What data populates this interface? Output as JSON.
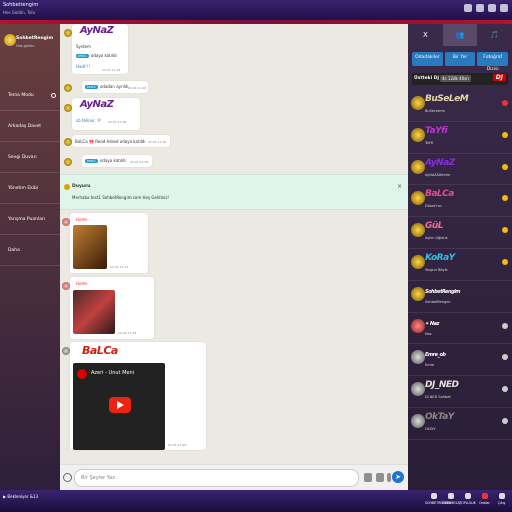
{
  "app": {
    "brand": "Sohbetrengim",
    "brand_sub": "Hos Geldin, Tela"
  },
  "sidebar": {
    "user_name": "SohbetRengim",
    "user_status": "Hos.geldin",
    "menu": [
      {
        "label": "Tema Modu"
      },
      {
        "label": "Arkadaş Davet"
      },
      {
        "label": "Sevgi Duvarı"
      },
      {
        "label": "Yönetim Ekibi"
      },
      {
        "label": "Yarışma Puanları"
      },
      {
        "label": "Daha"
      }
    ]
  },
  "chat": {
    "messages": [
      {
        "nick": "AyNaZ",
        "line1": "System",
        "tag": "test1",
        "text": "odaya katıldı",
        "extra": "Hadi!!!",
        "time": "22:01:11:28"
      },
      {
        "tag": "test1",
        "text": "odadan ayrıldı",
        "time": "22:01:11:28"
      },
      {
        "nick": "AyNaZ",
        "text": "sb telinor. :P",
        "time": "22:01:11:28"
      },
      {
        "text": "BaLCa 🎀 Read Asked odaya katıldı",
        "time": "22:01:11:28"
      },
      {
        "tag": "test1",
        "text": "odaya katıldı",
        "time": "22:01:11:28"
      }
    ],
    "notice": {
      "title": "Duyuru",
      "text": "Merhaba test1 SohbetRengim.com Hoş Geldiniz!"
    },
    "photo1": {
      "nick": "Helen",
      "time": "22:01:11:27"
    },
    "photo2": {
      "nick": "Helen",
      "time": "22:01:11:28"
    },
    "video": {
      "nick": "BaLCa",
      "title": "Azeri - Unut Meni",
      "time": "22:01:11:28"
    }
  },
  "input": {
    "placeholder": "Bir Şeyler Yaz"
  },
  "right": {
    "tabs": [
      "X",
      "👥",
      "🎵"
    ],
    "buttons": [
      "Odadakiler",
      "Bir Yer",
      "Fotoğraf Dizisi"
    ],
    "onair_label": "Üstteki Dj",
    "onair_time": "4s 12dk 40sn",
    "dj_badge": "DJ",
    "users": [
      {
        "name": "BuSeLeM",
        "status": "BuSeLemm",
        "color": "#e8d5a8"
      },
      {
        "name": "TaYfi",
        "status": "TaYfi",
        "color": "#b83ad0"
      },
      {
        "name": "AyNaZ",
        "status": "AyNaZ&Benim",
        "color": "#8a2be2"
      },
      {
        "name": "BaLCa",
        "status": "Dilara'nın",
        "color": "#e05090"
      },
      {
        "name": "GüL",
        "status": "Aşkın Ağlatık",
        "color": "#f07090"
      },
      {
        "name": "KoRaY",
        "status": "Yorgun Böyle",
        "color": "#30c0e0"
      },
      {
        "name": "SohbetRengim",
        "status": "SohbetRengim",
        "color": "#ffffff"
      },
      {
        "name": "✦ Naz",
        "status": "Naz",
        "color": "#ffffff"
      },
      {
        "name": "Emre_ob",
        "status": "Emre",
        "color": "#ffffff"
      },
      {
        "name": "DJ_NED",
        "status": "Dj NED Sohbet",
        "color": "#e0e0e0"
      },
      {
        "name": "OkTaY",
        "status": "OkTaY",
        "color": "#888888"
      }
    ]
  },
  "bottom": {
    "player": "Bekleniyor &13",
    "nav": [
      "SOHBETRENGIM",
      "ÖZELMESAJ",
      "TOPLULUK",
      "Odalar",
      "Çıkış"
    ]
  }
}
